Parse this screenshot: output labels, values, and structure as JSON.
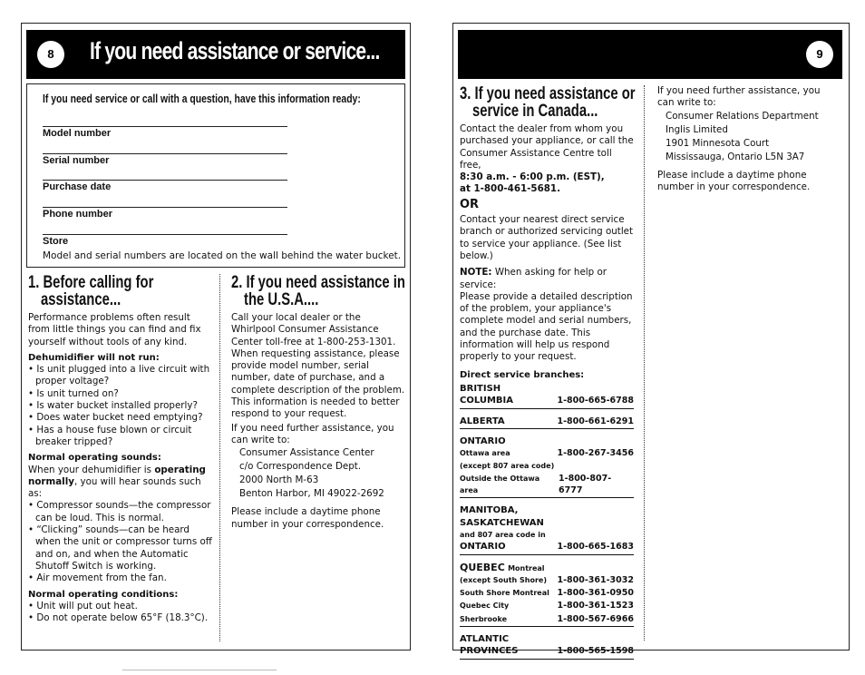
{
  "page8": {
    "page_number": "8",
    "banner_title": "If you need assistance or service...",
    "info_box": {
      "header": "If you need service or call with a question, have this information ready:",
      "fields": [
        "Model number",
        "Serial number",
        "Purchase date",
        "Phone number",
        "Store"
      ],
      "note": "Model and serial numbers are located on the wall behind the water bucket."
    },
    "section1": {
      "title_line1": "1. Before calling for",
      "title_line2": "assistance...",
      "intro": "Performance problems often result from little things you can find and fix yourself without tools of any kind.",
      "will_not_run_heading": "Dehumidifier will not run:",
      "will_not_run_items": [
        "• Is unit plugged into a live circuit with proper voltage?",
        "• Is unit turned on?",
        "• Is water bucket installed properly?",
        "• Does water bucket need emptying?",
        "• Has a house fuse blown or circuit breaker tripped?"
      ],
      "sounds_heading": "Normal operating sounds:",
      "sounds_intro_a": "When your dehumidifier is ",
      "sounds_intro_bold": "operating normally",
      "sounds_intro_b": ", you will hear sounds such as:",
      "sounds_items": [
        "• Compressor sounds—the compressor can be loud. This is normal.",
        "• “Clicking” sounds—can be heard when the unit or compressor turns off and on, and when the Automatic Shutoff Switch is working.",
        "• Air movement from the fan."
      ],
      "conditions_heading": "Normal operating conditions:",
      "conditions_items": [
        "• Unit will put out heat.",
        "• Do not operate below 65°F (18.3°C)."
      ]
    },
    "section2": {
      "title_line1": "2. If you need assistance in",
      "title_line2": "the U.S.A....",
      "body": "Call your local dealer or the Whirlpool Consumer Assistance Center toll-free at 1-800-253-1301. When requesting assistance, please provide model number, serial number, date of purchase, and a complete description of the problem. This information is needed to better respond to your request.",
      "write_intro": "If you need further assistance, you can write to:",
      "address": [
        "Consumer Assistance Center",
        "c/o Correspondence Dept.",
        "2000 North M-63",
        "Benton Harbor, MI 49022-2692"
      ],
      "closing": "Please include a daytime phone number in your correspondence."
    }
  },
  "page9": {
    "page_number": "9",
    "section3": {
      "title_line1": "3. If you need assistance or",
      "title_line2": "service in Canada...",
      "intro": "Contact the dealer from whom you purchased your appliance, or call the Consumer Assistance Centre toll free,",
      "hours": "8:30 a.m. - 6:00 p.m. (EST),",
      "phone": "at 1-800-461-5681.",
      "or": "OR",
      "contact_branch": "Contact your nearest direct service branch or authorized servicing outlet to service your appliance. (See list below.)",
      "note_label": "NOTE:",
      "note_text": " When asking for help or service:",
      "note_body": "Please provide a detailed description of the problem, your appliance's complete model and serial numbers, and the purchase date. This information will help us respond properly to your request.",
      "branches_heading": "Direct service branches:",
      "branches": {
        "bc_line1": "BRITISH",
        "bc_line2": "COLUMBIA",
        "bc_phone": "1-800-665-6788",
        "ab": "ALBERTA",
        "ab_phone": "1-800-661-6291",
        "on": "ONTARIO",
        "on_ottawa": "Ottawa area",
        "on_ottawa_phone": "1-800-267-3456",
        "on_except": "(except 807 area code)",
        "on_outside": "Outside the Ottawa area",
        "on_outside_phone": "1-800-807-6777",
        "mb_line1": "MANITOBA,",
        "mb_line2": "SASKATCHEWAN",
        "mb_line3": "and 807 area code in",
        "mb_line4": "ONTARIO",
        "mb_phone": "1-800-665-1683",
        "qc": "QUEBEC",
        "qc_montreal": "Montreal",
        "qc_except": "(except South Shore)",
        "qc_montreal_phone": "1-800-361-3032",
        "qc_south": "South Shore Montreal",
        "qc_south_phone": "1-800-361-0950",
        "qc_city": "Quebec City",
        "qc_city_phone": "1-800-361-1523",
        "qc_sher": "Sherbrooke",
        "qc_sher_phone": "1-800-567-6966",
        "atl_line1": "ATLANTIC",
        "atl_line2": "PROVINCES",
        "atl_phone": "1-800-565-1598"
      }
    },
    "right_column": {
      "write_intro": "If you need further assistance, you can write to:",
      "address": [
        "Consumer Relations Department",
        "Inglis Limited",
        "1901 Minnesota Court",
        "Mississauga, Ontario L5N 3A7"
      ],
      "closing": "Please include a daytime phone number in your correspondence."
    }
  }
}
